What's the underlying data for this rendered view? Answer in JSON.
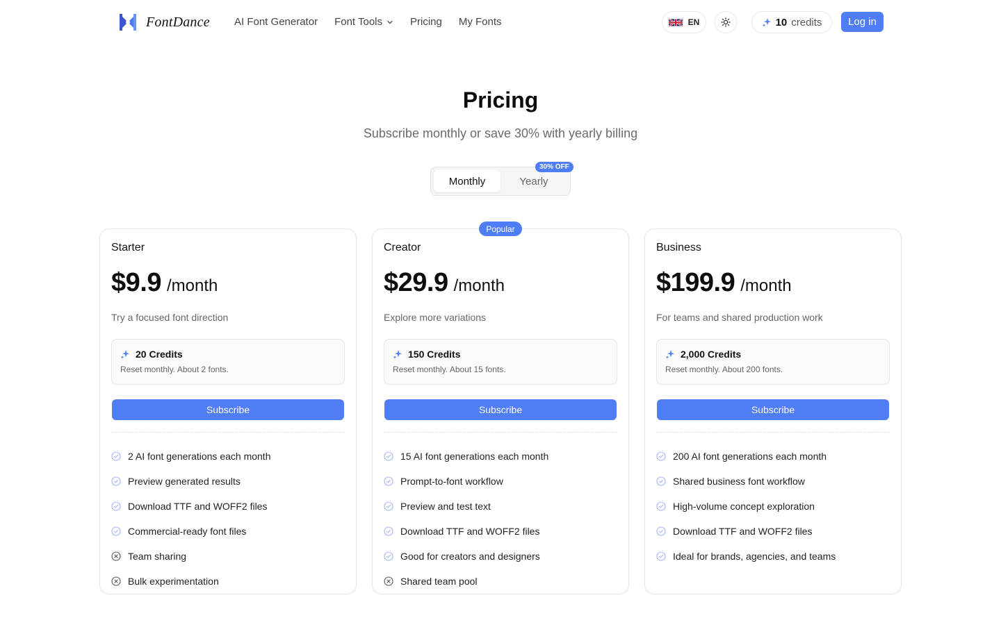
{
  "brand": {
    "name": "FontDance"
  },
  "nav": {
    "items": [
      {
        "label": "AI Font Generator"
      },
      {
        "label": "Font Tools",
        "has_dropdown": true
      },
      {
        "label": "Pricing"
      },
      {
        "label": "My Fonts"
      }
    ]
  },
  "header": {
    "language": "EN",
    "credits": {
      "count": "10",
      "label": "credits"
    },
    "login_label": "Log in"
  },
  "hero": {
    "title": "Pricing",
    "subtitle": "Subscribe monthly or save 30% with yearly billing"
  },
  "billing_toggle": {
    "options": [
      "Monthly",
      "Yearly"
    ],
    "selected": "Monthly",
    "badge": "30% OFF"
  },
  "plans": [
    {
      "name": "Starter",
      "price": "$9.9",
      "period": "/month",
      "description": "Try a focused font direction",
      "credits_title": "20 Credits",
      "credits_note": "Reset monthly. About 2 fonts.",
      "cta": "Subscribe",
      "features": [
        {
          "text": "2 AI font generations each month",
          "included": true
        },
        {
          "text": "Preview generated results",
          "included": true
        },
        {
          "text": "Download TTF and WOFF2 files",
          "included": true
        },
        {
          "text": "Commercial-ready font files",
          "included": true
        },
        {
          "text": "Team sharing",
          "included": false
        },
        {
          "text": "Bulk experimentation",
          "included": false
        }
      ]
    },
    {
      "name": "Creator",
      "badge": "Popular",
      "price": "$29.9",
      "period": "/month",
      "description": "Explore more variations",
      "credits_title": "150 Credits",
      "credits_note": "Reset monthly. About 15 fonts.",
      "cta": "Subscribe",
      "features": [
        {
          "text": "15 AI font generations each month",
          "included": true
        },
        {
          "text": "Prompt-to-font workflow",
          "included": true
        },
        {
          "text": "Preview and test text",
          "included": true
        },
        {
          "text": "Download TTF and WOFF2 files",
          "included": true
        },
        {
          "text": "Good for creators and designers",
          "included": true
        },
        {
          "text": "Shared team pool",
          "included": false
        }
      ]
    },
    {
      "name": "Business",
      "price": "$199.9",
      "period": "/month",
      "description": "For teams and shared production work",
      "credits_title": "2,000 Credits",
      "credits_note": "Reset monthly. About 200 fonts.",
      "cta": "Subscribe",
      "features": [
        {
          "text": "200 AI font generations each month",
          "included": true
        },
        {
          "text": "Shared business font workflow",
          "included": true
        },
        {
          "text": "High-volume concept exploration",
          "included": true
        },
        {
          "text": "Download TTF and WOFF2 files",
          "included": true
        },
        {
          "text": "Ideal for brands, agencies, and teams",
          "included": true
        }
      ]
    }
  ],
  "colors": {
    "accent": "#4f7df5",
    "text": "#111111",
    "muted": "#666666",
    "border": "#e3e3e3",
    "check": "#a5b4fc",
    "cross": "#555555"
  },
  "icons": {
    "logo": "fontdance-logo-icon",
    "flag": "uk-flag-icon",
    "theme": "sun-icon",
    "credits": "sparkle-icon",
    "included": "check-circle-icon",
    "excluded": "x-circle-icon",
    "dropdown": "chevron-down-icon"
  }
}
